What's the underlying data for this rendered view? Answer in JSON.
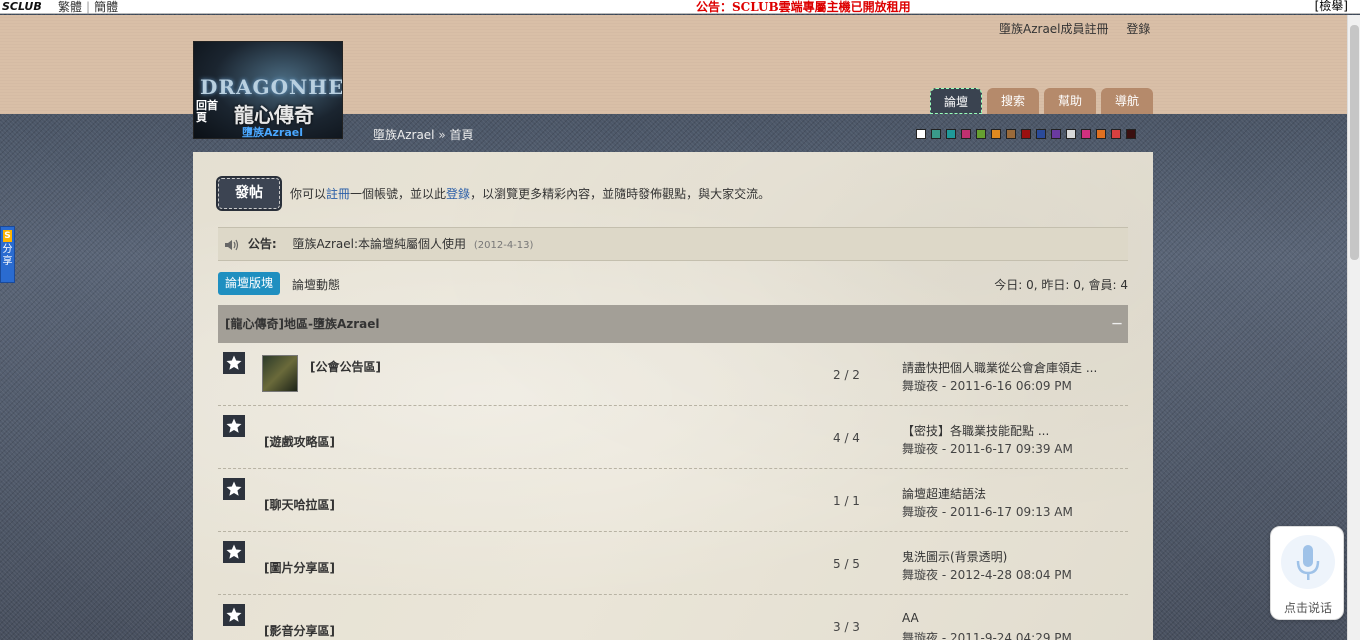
{
  "topbar": {
    "logo": "SCLUB",
    "lang_trad": "繁體",
    "lang_simp": "簡體",
    "notice": "公告：SCLUB雲端專屬主機已開放租用",
    "search": "[檢舉]"
  },
  "header": {
    "register_link": "墮族Azrael成員註冊",
    "login_link": "登錄",
    "logo_text_en": "DRAGONHE",
    "logo_text_cn": "龍心傳奇",
    "logo_sub": "墮族Azrael",
    "home_label": "回首頁",
    "tabs": [
      "論壇",
      "搜索",
      "幫助",
      "導航"
    ]
  },
  "breadcrumb": {
    "site": "墮族Azrael",
    "sep": "»",
    "page": "首頁"
  },
  "swatches": [
    "#ffffff",
    "#3a9a8a",
    "#1f9a9a",
    "#c03070",
    "#66a030",
    "#e08a20",
    "#9a6a3a",
    "#9a1010",
    "#2a4a9a",
    "#6a3aa0",
    "#d8d8d8",
    "#d03080",
    "#e07020",
    "#d84040",
    "#3a1010"
  ],
  "intro": {
    "post_button": "發帖",
    "text1": "你可以",
    "register": "註冊",
    "text2": "一個帳號，並以此",
    "login": "登錄",
    "text3": "，以瀏覽更多精彩內容，並隨時發佈觀點，與大家交流。"
  },
  "announcement": {
    "label": "公告:",
    "text": "墮族Azrael:本論壇純屬個人使用",
    "date": "(2012-4-13)"
  },
  "tabs": {
    "forum": "論壇版塊",
    "activity": "論壇動態"
  },
  "stats": "今日: 0, 昨日: 0, 會員: 4",
  "category": {
    "title": "[龍心傳奇]地區-墮族Azrael",
    "collapse": "－"
  },
  "forums": [
    {
      "name": "[公會公告區]",
      "count": "2 / 2",
      "last_title": "請盡快把個人職業從公會倉庫領走 ...",
      "last_meta": "舞璇夜 - 2011-6-16 06:09 PM",
      "has_thumb": true
    },
    {
      "name": "[遊戲攻略區]",
      "count": "4 / 4",
      "last_title": "【密技】各職業技能配點 ...",
      "last_meta": "舞璇夜 - 2011-6-17 09:39 AM",
      "has_thumb": false
    },
    {
      "name": "[聊天哈拉區]",
      "count": "1 / 1",
      "last_title": "論壇超連結語法",
      "last_meta": "舞璇夜 - 2011-6-17 09:13 AM",
      "has_thumb": false
    },
    {
      "name": "[圖片分享區]",
      "count": "5 / 5",
      "last_title": "鬼洗圖示(背景透明)",
      "last_meta": "舞璇夜 - 2012-4-28 08:04 PM",
      "has_thumb": false
    },
    {
      "name": "[影音分享區]",
      "count": "3 / 3",
      "last_title": "AA",
      "last_meta": "舞璇夜 - 2011-9-24 04:29 PM",
      "has_thumb": false
    }
  ],
  "share_float": {
    "badge": "S",
    "label": "分享"
  },
  "voice": {
    "label": "点击说话"
  },
  "icons": {
    "star": "star-icon",
    "speaker": "speaker-icon",
    "mic": "mic-icon"
  }
}
